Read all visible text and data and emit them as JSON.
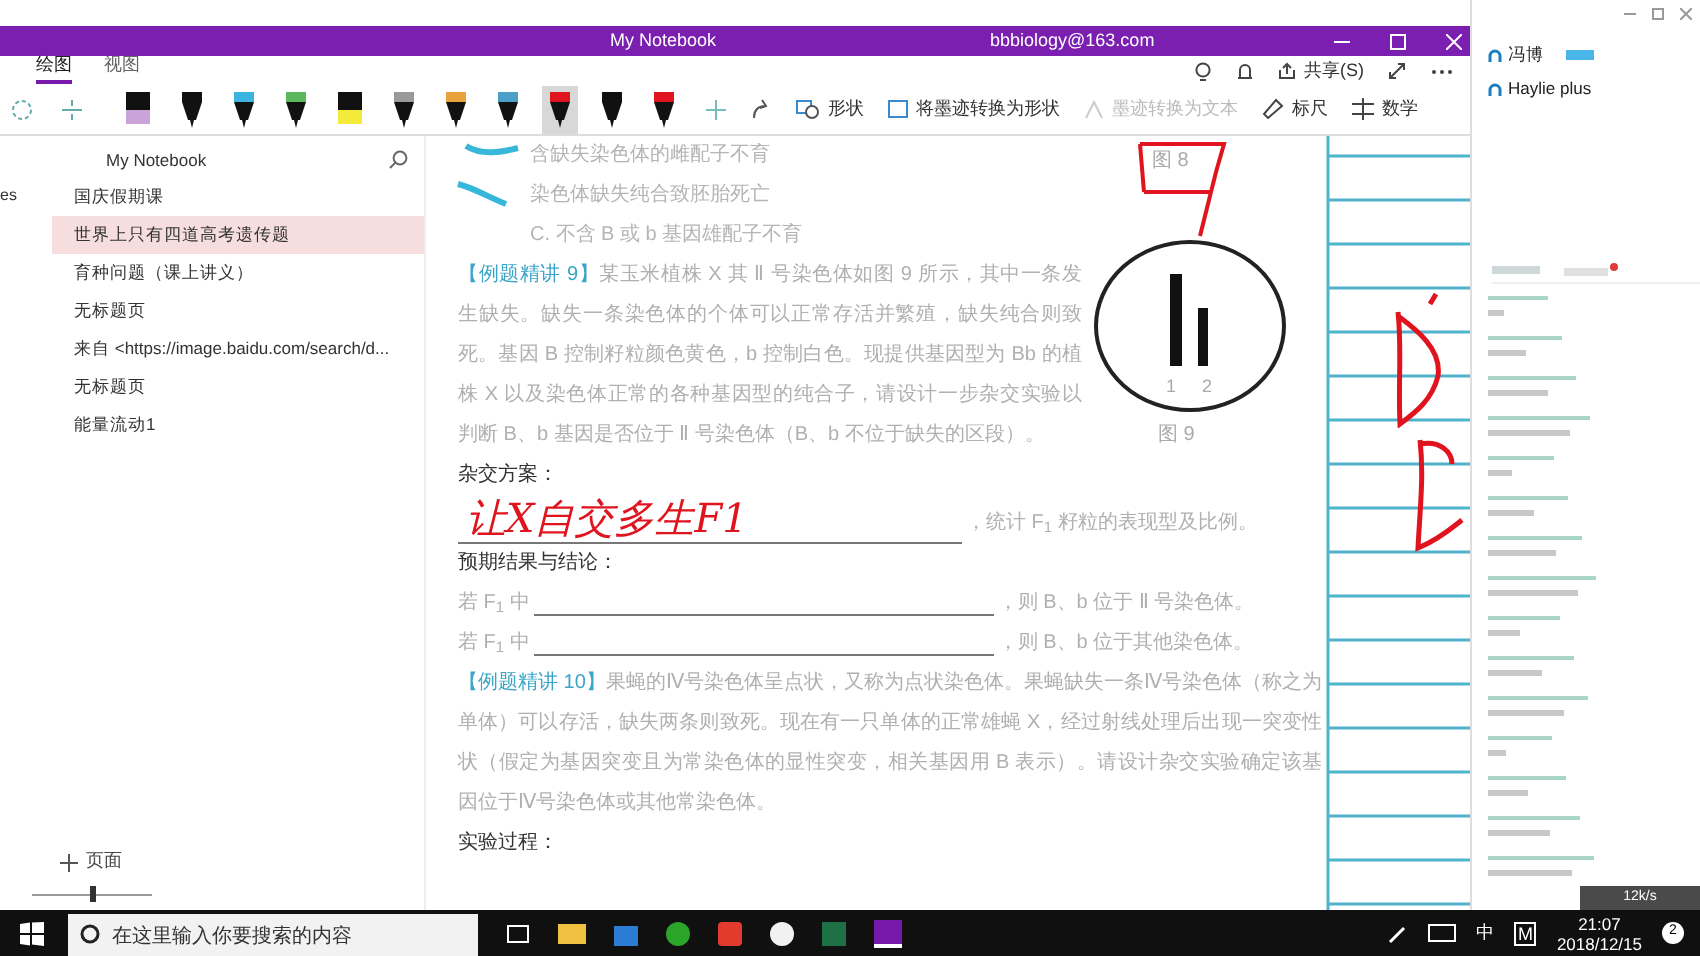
{
  "window": {
    "title": "My Notebook",
    "account": "bbbiology@163.com"
  },
  "ribbon": {
    "tabs": [
      {
        "label": "绘图",
        "selected": true
      },
      {
        "label": "视图",
        "selected": false
      }
    ],
    "pens": [
      {
        "color": "#c9a3d9",
        "kind": "highlighter",
        "selected": false
      },
      {
        "color": "#111111",
        "kind": "pen",
        "selected": false
      },
      {
        "color": "#3bb5e0",
        "kind": "pen",
        "selected": false
      },
      {
        "color": "#5cb85c",
        "kind": "pen",
        "selected": false
      },
      {
        "color": "#f3ea3a",
        "kind": "highlighter",
        "selected": false
      },
      {
        "color": "#9a9a9a",
        "kind": "pen",
        "selected": false
      },
      {
        "color": "#e9a13b",
        "kind": "pen",
        "selected": false
      },
      {
        "color": "#4aa0c8",
        "kind": "pen",
        "selected": false
      },
      {
        "color": "#e0141e",
        "kind": "pen",
        "selected": true
      },
      {
        "color": "#111111",
        "kind": "pen",
        "selected": false
      },
      {
        "color": "#e0141e",
        "kind": "pen",
        "selected": false
      }
    ],
    "tools": [
      {
        "label": "形状",
        "disabled": false,
        "kind": "shapes"
      },
      {
        "label": "将墨迹转换为形状",
        "disabled": false,
        "kind": "convert"
      },
      {
        "label": "墨迹转换为文本",
        "disabled": true,
        "kind": "text"
      },
      {
        "label": "标尺",
        "disabled": false,
        "kind": "ruler"
      },
      {
        "label": "数学",
        "disabled": false,
        "kind": "math"
      }
    ],
    "share": "共享(S)"
  },
  "sidebar": {
    "edge_text": "es",
    "notebook": "My Notebook",
    "add_page": "页面",
    "pages": [
      {
        "label": "国庆假期课",
        "selected": false
      },
      {
        "label": "世界上只有四道高考遗传题",
        "selected": true
      },
      {
        "label": "育种问题（课上讲义）",
        "selected": false
      },
      {
        "label": "无标题页",
        "selected": false
      },
      {
        "label": "来自 <https://image.baidu.com/search/d...",
        "selected": false
      },
      {
        "label": "无标题页",
        "selected": false
      },
      {
        "label": "能量流动1",
        "selected": false
      }
    ]
  },
  "page": {
    "lines": [
      {
        "kind": "option",
        "text": "含缺失染色体的雌配子不育"
      },
      {
        "kind": "option",
        "text": "染色体缺失纯合致胚胎死亡"
      },
      {
        "kind": "option",
        "text": "C. 不含 B 或 b 基因雄配子不育"
      },
      {
        "kind": "example",
        "tag": "【例题精讲 9】",
        "text": "某玉米植株 X 其 Ⅱ 号染色体如图 9 所示，其中一条发生缺失。缺失一条染色体的个体可以正常存活并繁殖，缺失纯合则致死。基因 B 控制籽粒颜色黄色，b 控制白色。现提供基因型为 Bb 的植株 X 以及染色体正常的各种基因型的纯合子，请设计一步杂交实验以判断 B、b 基因是否位于 Ⅱ 号染色体（B、b 不位于缺失的区段）。"
      },
      {
        "kind": "heading",
        "text": "杂交方案："
      },
      {
        "kind": "blank",
        "answer": "让X自交多生F1",
        "after": "，统计 F$_{1}$ 籽粒的表现型及比例。"
      },
      {
        "kind": "heading",
        "text": "预期结果与结论："
      },
      {
        "kind": "blank",
        "before": "若 F$_{1}$ 中",
        "after": "，则 B、b 位于 Ⅱ 号染色体。"
      },
      {
        "kind": "blank",
        "before": "若 F$_{1}$ 中",
        "after": "，则 B、b 位于其他染色体。"
      },
      {
        "kind": "example",
        "tag": "【例题精讲 10】",
        "text": "果蝇的Ⅳ号染色体呈点状，又称为点状染色体。果蝇缺失一条Ⅳ号染色体（称之为单体）可以存活，缺失两条则致死。现在有一只单体的正常雄蝇 X，经过射线处理后出现一突变性状（假定为基因突变且为常染色体的显性突变，相关基因用 B 表示）。请设计杂交实验确定该基因位于Ⅳ号染色体或其他常染色体。"
      },
      {
        "kind": "heading",
        "text": "实验过程："
      }
    ],
    "figure_8": "图 8",
    "figure_9": "图 9",
    "chromosome_labels": [
      "1",
      "2"
    ]
  },
  "zoom": {
    "level": 0.5
  },
  "participants": [
    {
      "name": "冯博",
      "badge": true
    },
    {
      "name": "Haylie plus",
      "badge": false
    }
  ],
  "network": "12k/s",
  "taskbar": {
    "search": {
      "placeholder": "在这里输入你要搜索的内容"
    },
    "ime": "中",
    "ime_mode": "M",
    "time": "21:07",
    "date": "2018/12/15",
    "notifications": "2"
  }
}
